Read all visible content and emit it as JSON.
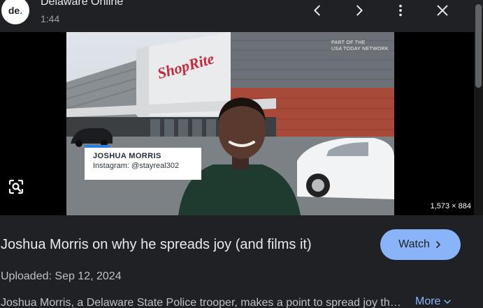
{
  "header": {
    "logo_text": "de",
    "logo_dot": ".",
    "source_name": "Delaware Online",
    "duration": "1:44"
  },
  "media": {
    "watermark_line1": "PART OF THE",
    "watermark_line2": "USA TODAY NETWORK",
    "storefront_sign": "ShopRite",
    "nameplate_name": "JOSHUA MORRIS",
    "nameplate_handle": "Instagram: @stayreal302",
    "dimensions": "1,573 × 884"
  },
  "info": {
    "title": "Joshua Morris on why he spreads joy (and films it)",
    "watch_label": "Watch",
    "uploaded": "Uploaded: Sep 12, 2024",
    "description": "Joshua Morris, a Delaware State Police trooper, makes a point to spread joy through his videos.",
    "more_label": "More"
  },
  "icons": {
    "prev": "chevron-left-icon",
    "next": "chevron-right-icon",
    "menu": "more-vert-icon",
    "close": "close-icon",
    "lens": "lens-search-icon",
    "watch_chevron": "chevron-right-icon",
    "more_chevron": "chevron-down-icon"
  },
  "colors": {
    "background": "#202124",
    "accent": "#8ab4f8",
    "text": "#e8eaed",
    "muted": "#bdc1c6",
    "nameplate_bar": "#2a7de1"
  }
}
